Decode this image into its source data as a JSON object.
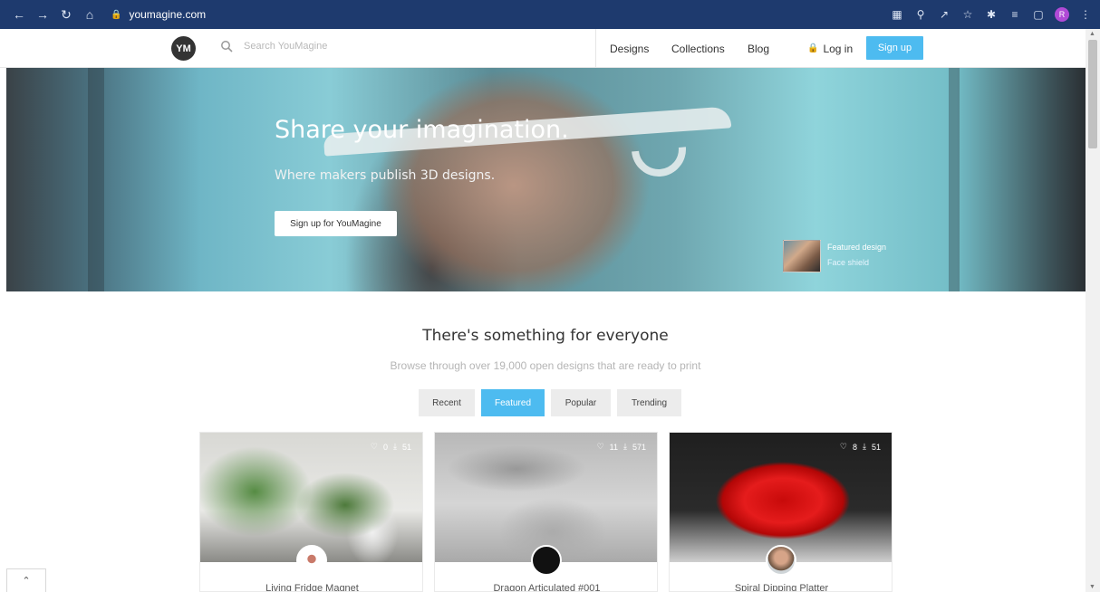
{
  "browser": {
    "url": "youmagine.com",
    "profile_initial": "R"
  },
  "header": {
    "logo_text": "YM",
    "search_placeholder": "Search YouMagine",
    "nav": {
      "designs": "Designs",
      "collections": "Collections",
      "blog": "Blog",
      "login": "Log in",
      "signup": "Sign up"
    }
  },
  "hero": {
    "title": "Share your imagination.",
    "subtitle": "Where makers publish 3D designs.",
    "cta": "Sign up for YouMagine",
    "featured_label": "Featured design",
    "featured_name": "Face shield"
  },
  "section": {
    "title": "There's something for everyone",
    "subtitle": "Browse through over 19,000 open designs that are ready to print",
    "tabs": [
      "Recent",
      "Featured",
      "Popular",
      "Trending"
    ],
    "active_tab": "Featured"
  },
  "cards": [
    {
      "name": "Living Fridge Magnet",
      "likes": "0",
      "downloads": "51"
    },
    {
      "name": "Dragon Articulated #001",
      "likes": "11",
      "downloads": "571"
    },
    {
      "name": "Spiral Dipping Platter",
      "likes": "8",
      "downloads": "51"
    }
  ],
  "colors": {
    "accent": "#4dbbf0",
    "chrome": "#1e3a6e"
  }
}
